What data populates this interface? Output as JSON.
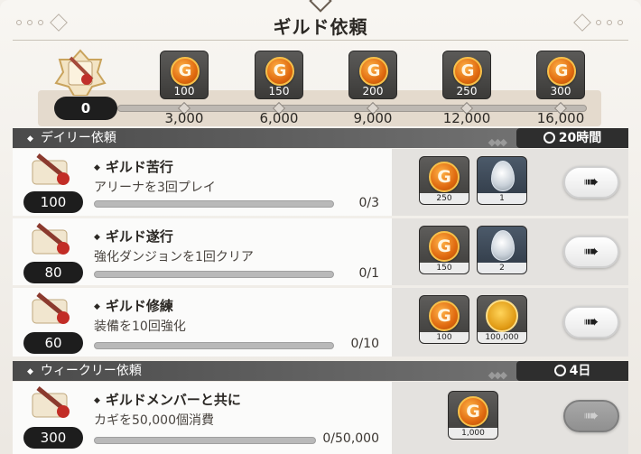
{
  "title": "ギルド依頼",
  "progress": {
    "current": "0",
    "milestones": [
      {
        "reward_qty": "100",
        "points": "3,000"
      },
      {
        "reward_qty": "150",
        "points": "6,000"
      },
      {
        "reward_qty": "200",
        "points": "9,000"
      },
      {
        "reward_qty": "250",
        "points": "12,000"
      },
      {
        "reward_qty": "300",
        "points": "16,000"
      }
    ],
    "coin_letter": "G"
  },
  "daily": {
    "header": "デイリー依頼",
    "timer": "20時間",
    "quests": [
      {
        "points": "100",
        "name": "ギルド苦行",
        "desc": "アリーナを3回プレイ",
        "progress": "0/3",
        "progress_fraction": 0,
        "rewards": [
          {
            "type": "coin",
            "qty": "250"
          },
          {
            "type": "egg",
            "qty": "1"
          }
        ]
      },
      {
        "points": "80",
        "name": "ギルド遂行",
        "desc": "強化ダンジョンを1回クリア",
        "progress": "0/1",
        "progress_fraction": 0,
        "rewards": [
          {
            "type": "coin",
            "qty": "150"
          },
          {
            "type": "egg",
            "qty": "2"
          }
        ]
      },
      {
        "points": "60",
        "name": "ギルド修練",
        "desc": "装備を10回強化",
        "progress": "0/10",
        "progress_fraction": 0,
        "rewards": [
          {
            "type": "coin",
            "qty": "100"
          },
          {
            "type": "badge",
            "qty": "100,000"
          }
        ]
      }
    ]
  },
  "weekly": {
    "header": "ウィークリー依頼",
    "timer": "4日",
    "quests": [
      {
        "points": "300",
        "name": "ギルドメンバーと共に",
        "desc": "カギを50,000個消費",
        "progress": "0/50,000",
        "progress_fraction": 0,
        "rewards": [
          {
            "type": "coin",
            "qty": "1,000"
          }
        ]
      }
    ]
  },
  "icons": {
    "coin": "gold-coin-icon",
    "egg": "silver-egg-icon",
    "badge": "gold-medal-icon",
    "go": "double-arrow-icon",
    "timer": "stopwatch-icon",
    "quest": "scroll-quill-icon"
  },
  "colors": {
    "coin": "#e06a10",
    "dark": "#1d1d1d",
    "header": "#5a5a5a"
  }
}
